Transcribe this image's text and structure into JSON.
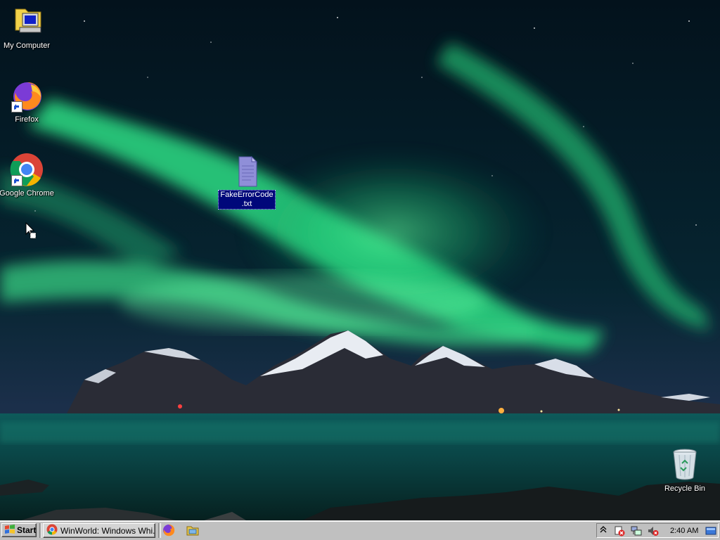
{
  "desktop": {
    "icons": [
      {
        "label": "My Computer"
      },
      {
        "label": "Firefox"
      },
      {
        "label": "Google Chrome"
      },
      {
        "label": "FakeErrorCode\n.txt"
      },
      {
        "label": "Recycle Bin"
      }
    ]
  },
  "taskbar": {
    "start_label": "Start",
    "task_button_label": "WinWorld: Windows Whi...",
    "clock": "2:40 AM"
  },
  "colors": {
    "taskbar_bg": "#c0c0c0",
    "selection": "#00087a",
    "aurora": "#2ee08a"
  }
}
